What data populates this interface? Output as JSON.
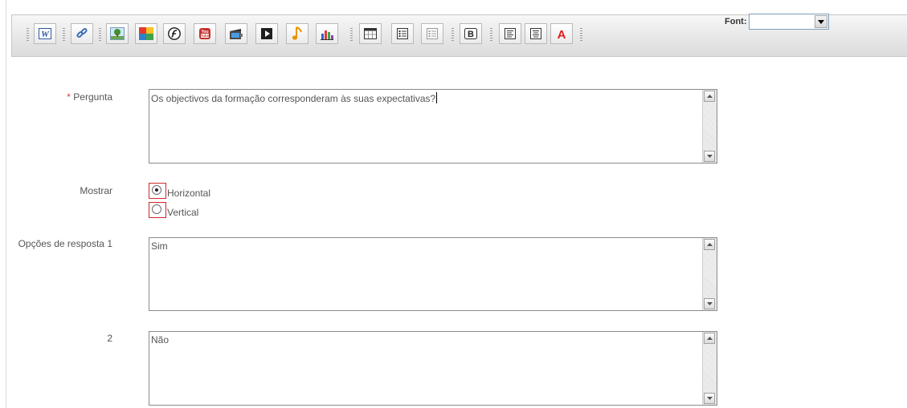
{
  "toolbar": {
    "buttons": [
      {
        "name": "word-icon"
      },
      {
        "name": "link-icon"
      },
      {
        "name": "image-icon"
      },
      {
        "name": "gallery-icon"
      },
      {
        "name": "flash-icon"
      },
      {
        "name": "youtube-icon"
      },
      {
        "name": "video-icon"
      },
      {
        "name": "media-player-icon"
      },
      {
        "name": "audio-icon"
      },
      {
        "name": "chart-icon"
      },
      {
        "name": "table-icon"
      },
      {
        "name": "list-icon"
      },
      {
        "name": "form-list-icon"
      },
      {
        "name": "bold-icon"
      },
      {
        "name": "align-left-icon"
      },
      {
        "name": "align-center-icon"
      },
      {
        "name": "font-color-icon"
      }
    ],
    "font_label": "Font:",
    "font_value": ""
  },
  "form": {
    "question_label": "Pergunta",
    "question_required_mark": "*",
    "question_value": "Os objectivos da formação corresponderam às suas expectativas?",
    "display_label": "Mostrar",
    "display_options": [
      {
        "label": "Horizontal",
        "selected": true
      },
      {
        "label": "Vertical",
        "selected": false
      }
    ],
    "answers_label": "Opções de resposta",
    "answers": [
      {
        "number": "1",
        "value": "Sim"
      },
      {
        "number": "2",
        "value": "Não"
      }
    ]
  }
}
